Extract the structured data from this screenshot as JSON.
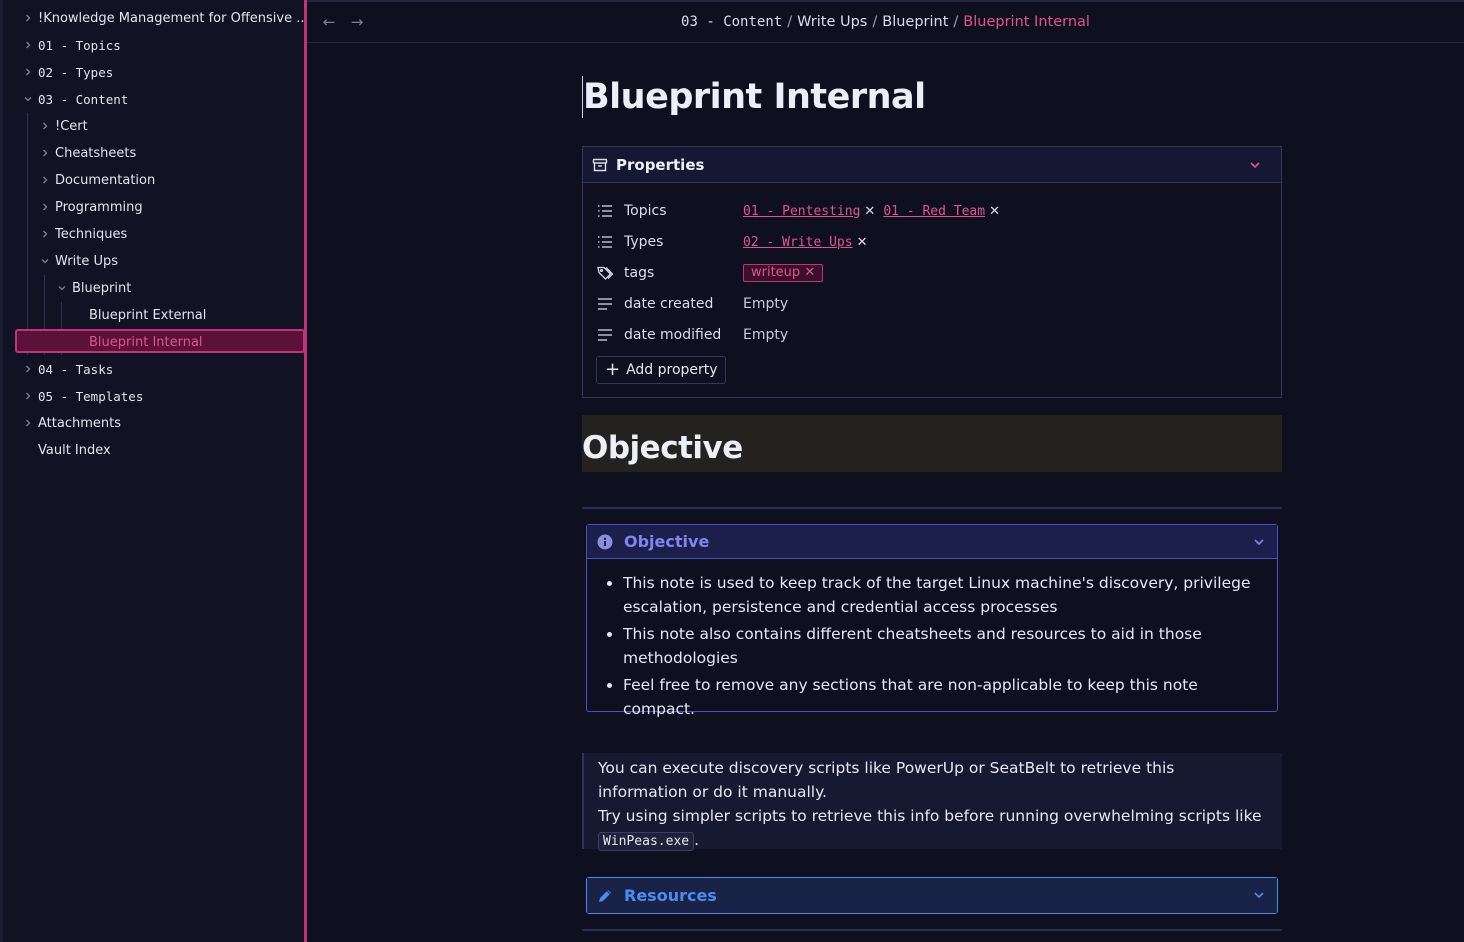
{
  "sidebar": {
    "items": [
      {
        "label": "!Knowledge Management for Offensive ...",
        "chev": "right"
      },
      {
        "label": "01 - Topics",
        "chev": "right"
      },
      {
        "label": "02 - Types",
        "chev": "right"
      },
      {
        "label": "03 - Content",
        "chev": "down"
      },
      {
        "label": "!Cert",
        "chev": "right"
      },
      {
        "label": "Cheatsheets",
        "chev": "right"
      },
      {
        "label": "Documentation",
        "chev": "right"
      },
      {
        "label": "Programming",
        "chev": "right"
      },
      {
        "label": "Techniques",
        "chev": "right"
      },
      {
        "label": "Write Ups",
        "chev": "down"
      },
      {
        "label": "Blueprint",
        "chev": "down"
      },
      {
        "label": "Blueprint External",
        "chev": "none"
      },
      {
        "label": "Blueprint Internal",
        "chev": "none"
      },
      {
        "label": "04 - Tasks",
        "chev": "right"
      },
      {
        "label": "05 - Templates",
        "chev": "right"
      },
      {
        "label": "Attachments",
        "chev": "right"
      },
      {
        "label": "Vault Index",
        "chev": "none"
      }
    ]
  },
  "breadcrumb": [
    "03 - Content",
    "Write Ups",
    "Blueprint",
    "Blueprint Internal"
  ],
  "note": {
    "title": "Blueprint Internal",
    "properties_label": "Properties",
    "properties": {
      "topics_key": "Topics",
      "topics": [
        "01 - Pentesting",
        "01 - Red Team"
      ],
      "types_key": "Types",
      "types": [
        "02 - Write Ups"
      ],
      "tags_key": "tags",
      "tag": "writeup",
      "date_created_key": "date created",
      "date_created": "Empty",
      "date_modified_key": "date modified",
      "date_modified": "Empty",
      "add_property": "Add property"
    },
    "heading": "Objective",
    "callout_objective": {
      "title": "Objective",
      "bullets": [
        "This note is used to keep track of the target Linux machine's discovery, privilege escalation, persistence and credential access processes",
        "This note also contains different cheatsheets and resources to aid in those methodologies",
        "Feel free to remove any sections that are non-applicable to keep this note compact."
      ]
    },
    "quote": {
      "line1": "You can execute discovery scripts like PowerUp or SeatBelt to retrieve this information or do it manually.",
      "line2": "Try using simpler scripts to retrieve this info before running overwhelming scripts like",
      "code": "WinPeas.exe",
      "end": "."
    },
    "callout_resources": {
      "title": "Resources"
    }
  },
  "colors": {
    "accent": "#c2327a",
    "link": "#e0548e",
    "callout_info": "#7b7ff0",
    "callout_resources": "#4d8bf0"
  }
}
